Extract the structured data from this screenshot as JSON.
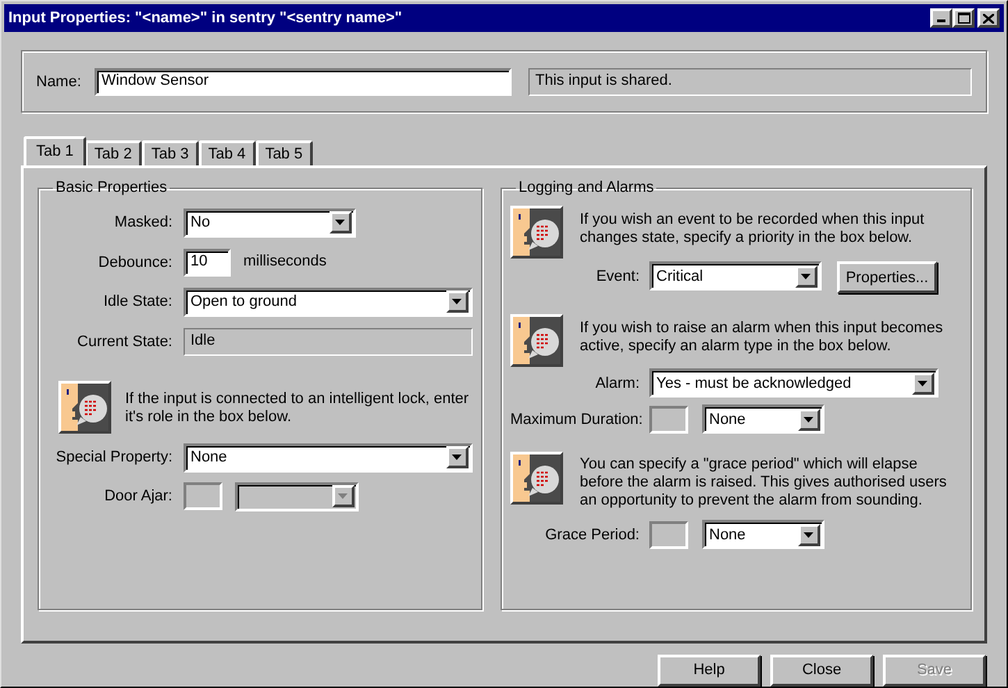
{
  "window": {
    "title": "Input Properties: \"<name>\" in sentry \"<sentry name>\""
  },
  "name_group": {
    "label": "Name:",
    "value": "Window Sensor",
    "note": "This input is shared."
  },
  "tabs": [
    {
      "label": "Tab 1",
      "selected": true
    },
    {
      "label": "Tab 2",
      "selected": false
    },
    {
      "label": "Tab 3",
      "selected": false
    },
    {
      "label": "Tab 4",
      "selected": false
    },
    {
      "label": "Tab 5",
      "selected": false
    }
  ],
  "basic_properties": {
    "title": "Basic Properties",
    "masked": {
      "label": "Masked:",
      "value": "No",
      "disabled": false
    },
    "debounce": {
      "label": "Debounce:",
      "value": "10",
      "unit": "milliseconds",
      "disabled": false
    },
    "idle_state": {
      "label": "Idle State:",
      "value": "Open to ground",
      "disabled": false
    },
    "current_state": {
      "label": "Current State:",
      "value": "Idle"
    },
    "lock_hint": "If the input is connected to an intelligent lock, enter it's role in the box below.",
    "special_property": {
      "label": "Special Property:",
      "value": "None",
      "disabled": false
    },
    "door_ajar": {
      "label": "Door Ajar:",
      "box_disabled": true,
      "combo_disabled": true
    }
  },
  "logging_and_alarms": {
    "title": "Logging and Alarms",
    "event_hint": "If you wish an event to be recorded when this input changes state, specify a priority in the box below.",
    "event": {
      "label": "Event:",
      "value": "Critical",
      "disabled": false
    },
    "properties_button": {
      "label": "Properties...",
      "disabled": false
    },
    "alarm_hint": "If you wish to raise an alarm when this input becomes active, specify an alarm type in the box below.",
    "alarm": {
      "label": "Alarm:",
      "value": "Yes - must be acknowledged",
      "disabled": false
    },
    "maximum_duration": {
      "label": "Maximum Duration:",
      "box_disabled": true,
      "value": "None",
      "combo_disabled": false
    },
    "grace_hint": "You can specify a \"grace period\" which will elapse before the alarm is raised.  This gives authorised users an opportunity to prevent the alarm from sounding.",
    "grace_period": {
      "label": "Grace Period:",
      "box_disabled": true,
      "value": "None",
      "combo_disabled": false
    }
  },
  "buttons": [
    {
      "label": "Help",
      "disabled": false
    },
    {
      "label": "Close",
      "disabled": false
    },
    {
      "label": "Save",
      "disabled": true
    }
  ]
}
